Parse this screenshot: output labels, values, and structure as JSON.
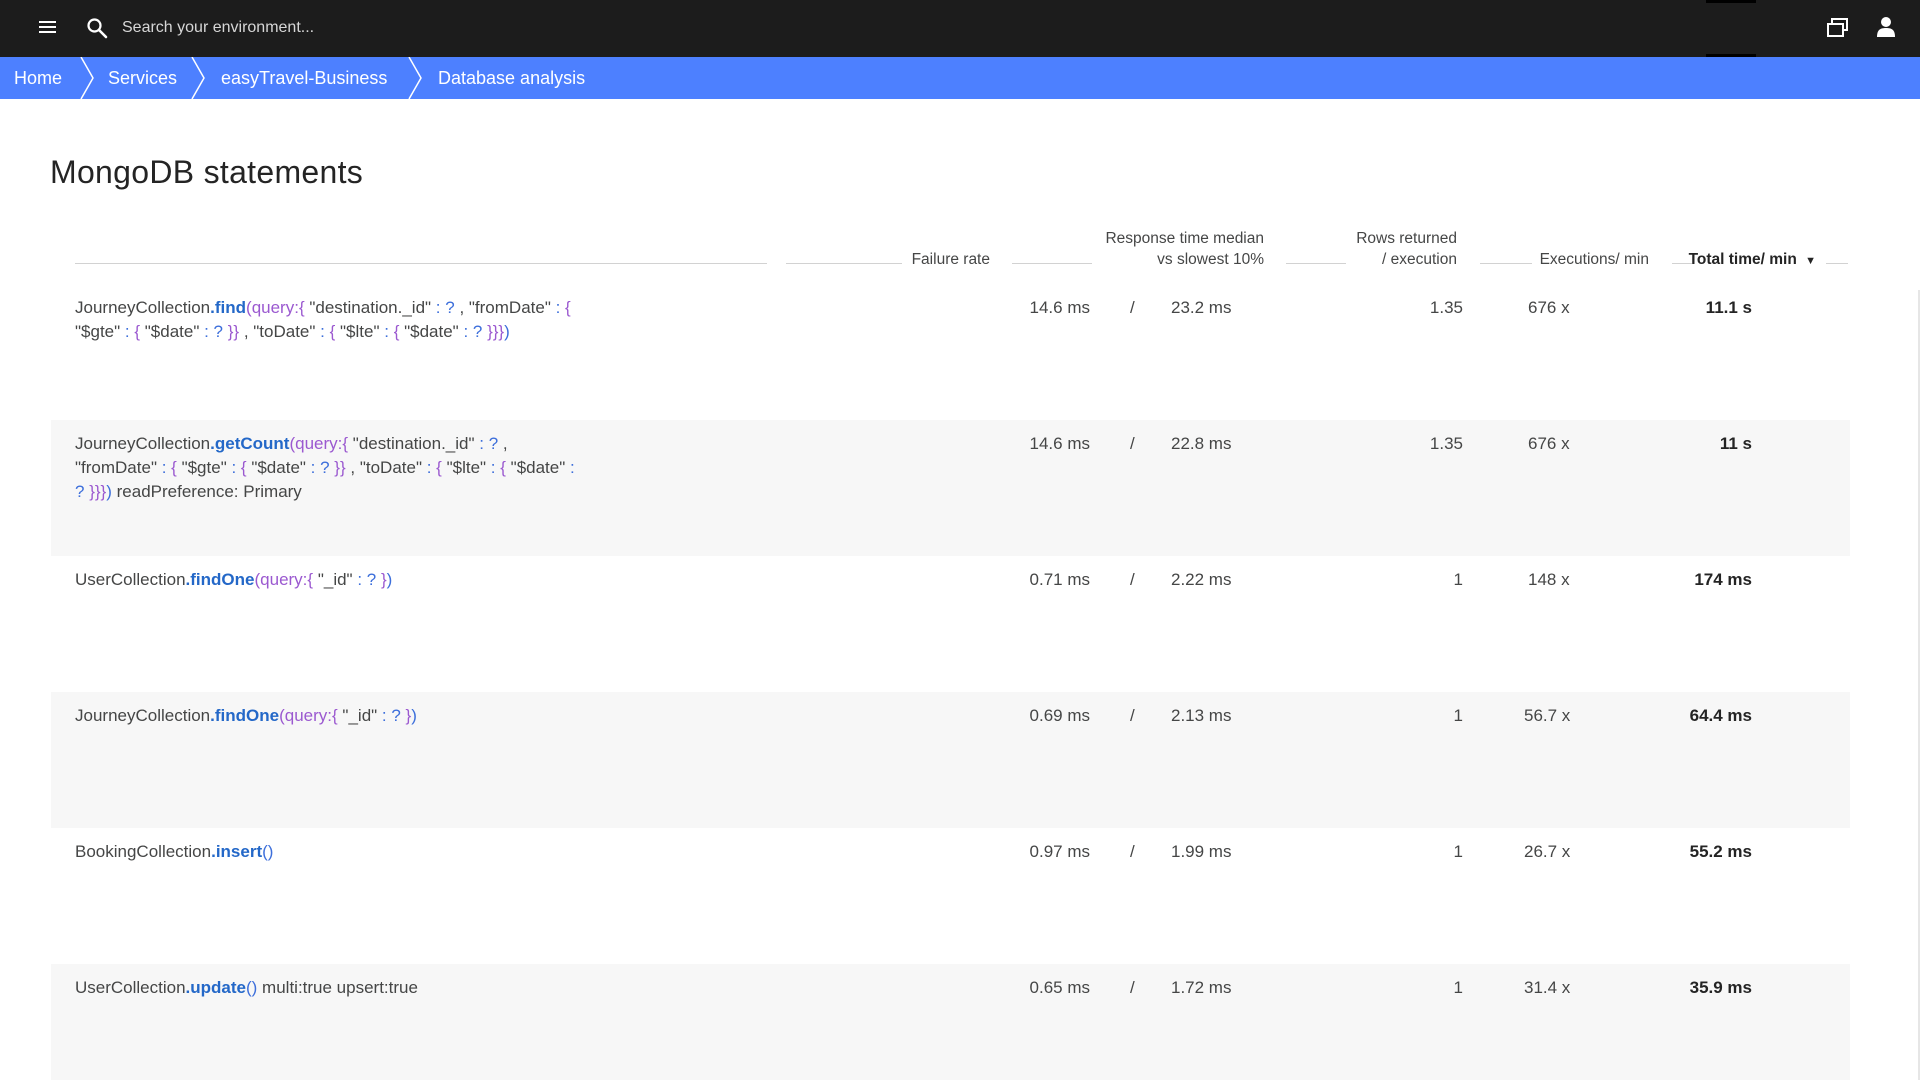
{
  "topbar": {
    "search_placeholder": "Search your environment..."
  },
  "breadcrumb": {
    "items": [
      {
        "label": "Home"
      },
      {
        "label": "Services"
      },
      {
        "label": "easyTravel-Business"
      },
      {
        "label": "Database analysis"
      }
    ]
  },
  "page": {
    "title": "MongoDB statements"
  },
  "table": {
    "headers": {
      "failure_rate": "Failure rate",
      "response_time_line1": "Response time median",
      "response_time_line2": "vs slowest 10%",
      "rows_line1": "Rows returned",
      "rows_line2": "/ execution",
      "executions": "Executions/ min",
      "total_time": "Total time/ min",
      "sort_indicator": "▼"
    },
    "separator": "/",
    "rows": [
      {
        "collection": "JourneyCollection",
        "method": ".find",
        "median": "14.6 ms",
        "slowest": "23.2 ms",
        "rows": "1.35",
        "executions": "676 x",
        "total": "11.1 s"
      },
      {
        "collection": "JourneyCollection",
        "method": ".getCount",
        "median": "14.6 ms",
        "slowest": "22.8 ms",
        "rows": "1.35",
        "executions": "676 x",
        "total": "11 s"
      },
      {
        "collection": "UserCollection",
        "method": ".findOne",
        "median": "0.71 ms",
        "slowest": "2.22 ms",
        "rows": "1",
        "executions": "148 x",
        "total": "174 ms"
      },
      {
        "collection": "JourneyCollection",
        "method": ".findOne",
        "median": "0.69 ms",
        "slowest": "2.13 ms",
        "rows": "1",
        "executions": "56.7 x",
        "total": "64.4 ms"
      },
      {
        "collection": "BookingCollection",
        "method": ".insert",
        "median": "0.97 ms",
        "slowest": "1.99 ms",
        "rows": "1",
        "executions": "26.7 x",
        "total": "55.2 ms"
      },
      {
        "collection": "UserCollection",
        "method": ".update",
        "median": "0.65 ms",
        "slowest": "1.72 ms",
        "rows": "1",
        "executions": "31.4 x",
        "total": "35.9 ms"
      }
    ],
    "query_parts": {
      "find": {
        "open": "(query:",
        "b1": "{",
        "k1": " \"destination._id\" ",
        "c1": ":",
        "q1": " ? ",
        "t1": ", \"fromDate\" ",
        "c2": ":",
        "b2": " {",
        "k2": "\"$gte\" ",
        "c3": ":",
        "b3": " {",
        "k3": " \"$date\" ",
        "c4": ":",
        "q2": " ? ",
        "b4": "}}",
        "t2": " , \"toDate\" ",
        "c5": ":",
        "b5": " {",
        "k4": " \"$lte\" ",
        "c6": ":",
        "b6": " {",
        "k5": " \"$date\" ",
        "c7": ":",
        "q3": " ? ",
        "b7": "}}}",
        "close": ")"
      },
      "getCount": {
        "open": "(query:",
        "b1": "{",
        "k1": " \"destination._id\" ",
        "c1": ":",
        "q1": " ? ",
        "t1": ",",
        "t1b": "\"fromDate\" ",
        "c2": ":",
        "b2": " {",
        "k2": " \"$gte\" ",
        "c3": ":",
        "b3": " {",
        "k3": " \"$date\" ",
        "c4": ":",
        "q2": " ? ",
        "b4": "}}",
        "t2": " , \"toDate\" ",
        "c5": ":",
        "b5": " {",
        "k4": " \"$lte\" ",
        "c6": ":",
        "b6": " {",
        "k5": " \"$date\" ",
        "c7": ":",
        "q3": "? ",
        "b7": "}}}",
        "close": ")",
        "suffix": " readPreference: Primary"
      },
      "findOneUser": {
        "open": "(query:",
        "b1": "{",
        "k1": " \"_id\" ",
        "c1": ":",
        "q1": " ? ",
        "b2": "}",
        "close": ")"
      },
      "findOneJourney": {
        "open": "(query:",
        "b1": "{",
        "k1": " \"_id\" ",
        "c1": ":",
        "q1": " ? ",
        "b2": "}",
        "close": ")"
      },
      "insert": {
        "parens": "()"
      },
      "update": {
        "parens": "()",
        "suffix": " multi:true upsert:true"
      }
    }
  }
}
